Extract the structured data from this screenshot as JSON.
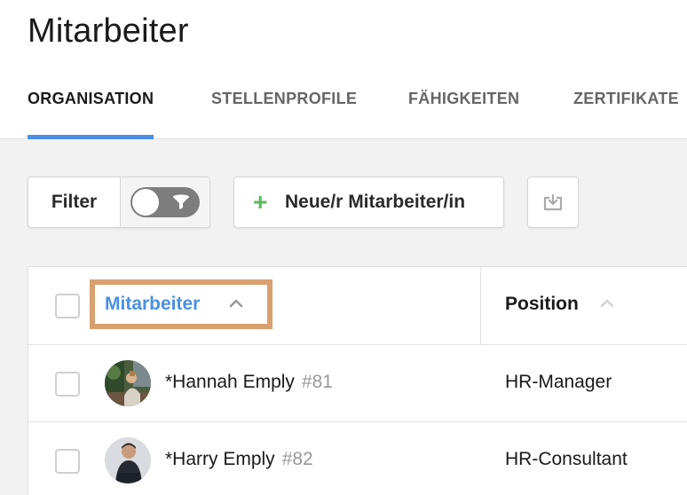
{
  "page": {
    "title": "Mitarbeiter"
  },
  "tabs": [
    {
      "label": "ORGANISATION",
      "active": true
    },
    {
      "label": "STELLENPROFILE",
      "active": false
    },
    {
      "label": "FÄHIGKEITEN",
      "active": false
    },
    {
      "label": "ZERTIFIKATE",
      "active": false
    }
  ],
  "toolbar": {
    "filter_label": "Filter",
    "filter_toggle_on": false,
    "new_label": "Neue/r Mitarbeiter/in",
    "new_icon": "plus-icon",
    "export_icon": "download-icon"
  },
  "table": {
    "columns": [
      {
        "label": "Mitarbeiter",
        "sorted": true
      },
      {
        "label": "Position",
        "sorted": false
      }
    ],
    "rows": [
      {
        "name": "*Hannah Emply",
        "id": "#81",
        "position": "HR-Manager"
      },
      {
        "name": "*Harry Emply",
        "id": "#82",
        "position": "HR-Consultant"
      }
    ]
  },
  "colors": {
    "accent": "#4a90e2",
    "plus": "#5cb85c",
    "highlight": "#d9a06f",
    "toggle": "#7d7d7d"
  }
}
